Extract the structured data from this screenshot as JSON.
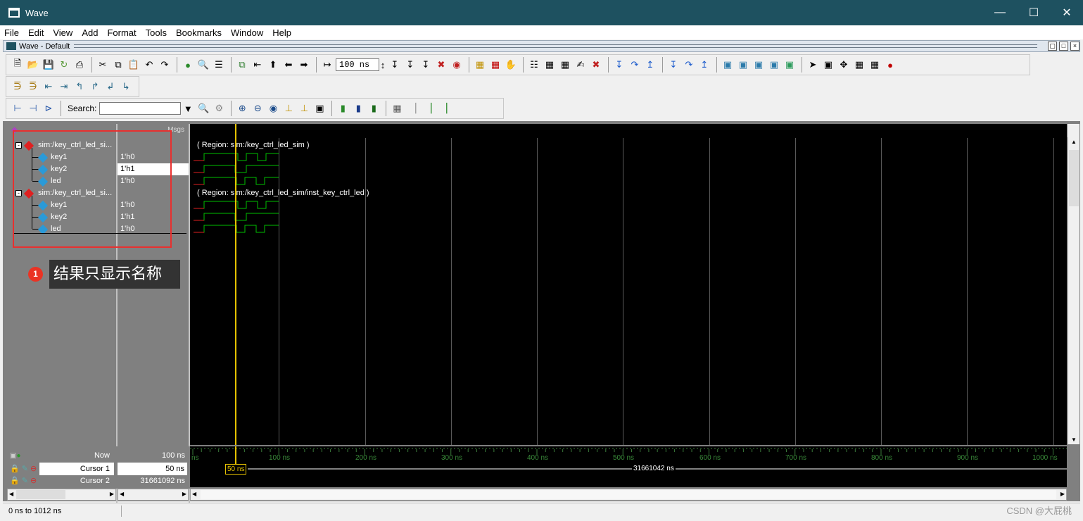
{
  "window": {
    "title": "Wave"
  },
  "menubar": {
    "items": [
      {
        "u": "F",
        "rest": "ile"
      },
      {
        "u": "E",
        "rest": "dit"
      },
      {
        "u": "V",
        "rest": "iew"
      },
      {
        "u": "A",
        "rest": "dd"
      },
      {
        "u": "",
        "rest": "Format",
        "u2": "o"
      },
      {
        "u": "T",
        "rest": "ools"
      },
      {
        "u": "",
        "rest": "Bookmarks"
      },
      {
        "u": "W",
        "rest": "indow"
      },
      {
        "u": "H",
        "rest": "elp"
      }
    ]
  },
  "menu_labels": [
    "File",
    "Edit",
    "View",
    "Add",
    "Format",
    "Tools",
    "Bookmarks",
    "Window",
    "Help"
  ],
  "subwindow": {
    "title": "Wave - Default"
  },
  "toolbar": {
    "time_value": "100 ns",
    "search_label": "Search:",
    "search_value": ""
  },
  "panes": {
    "msgs_header": "Msgs"
  },
  "signals": [
    {
      "name": "sim:/key_ctrl_led_si...",
      "value": "",
      "group": true
    },
    {
      "name": "key1",
      "value": "1'h0",
      "group": false
    },
    {
      "name": "key2",
      "value": "1'h1",
      "group": false,
      "selected": true
    },
    {
      "name": "led",
      "value": "1'h0",
      "group": false
    },
    {
      "name": "sim:/key_ctrl_led_si...",
      "value": "",
      "group": true
    },
    {
      "name": "key1",
      "value": "1'h0",
      "group": false
    },
    {
      "name": "key2",
      "value": "1'h1",
      "group": false
    },
    {
      "name": "led",
      "value": "1'h0",
      "group": false
    }
  ],
  "regions": [
    {
      "label": "( Region: sim:/key_ctrl_led_sim )"
    },
    {
      "label": "( Region: sim:/key_ctrl_led_sim/inst_key_ctrl_led )"
    }
  ],
  "timeline": {
    "ticks": [
      "ns",
      "100 ns",
      "200 ns",
      "300 ns",
      "400 ns",
      "500 ns",
      "600 ns",
      "700 ns",
      "800 ns",
      "900 ns",
      "1000 ns"
    ],
    "now_label": "Now",
    "now_value": "100 ns",
    "cursor1_label": "Cursor 1",
    "cursor1_value": "50 ns",
    "cursor1_flag": "50 ns",
    "cursor2_label": "Cursor 2",
    "cursor2_value": "31661092 ns",
    "delta_label": "31661042 ns"
  },
  "annotation": {
    "badge": "1",
    "text": "结果只显示名称"
  },
  "status": {
    "range": "0 ns to 1012 ns"
  },
  "watermark": "CSDN @大屁桃",
  "colors": {
    "titlebar": "#1e5160",
    "wave_green": "#00c000",
    "cursor_yellow": "#e6c200",
    "anno_red": "#e8302f"
  }
}
